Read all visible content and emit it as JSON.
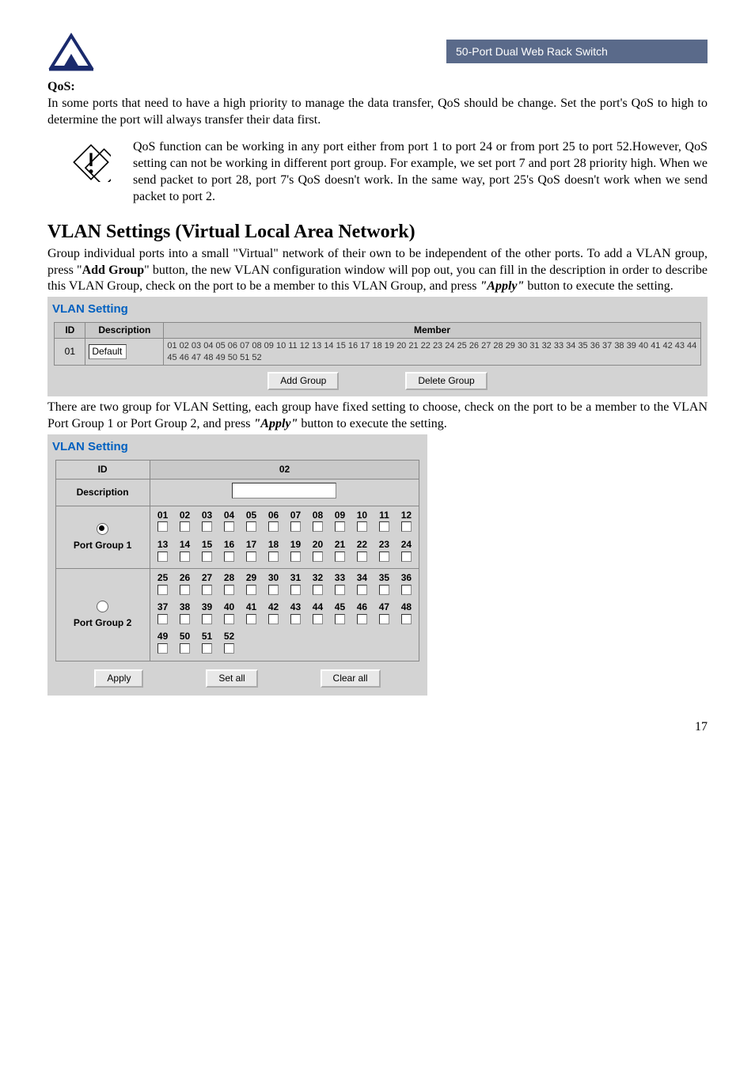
{
  "header": {
    "product": "50-Port Dual Web Rack Switch"
  },
  "qos": {
    "label": "QoS:",
    "body": "In some ports that need to have a high priority to manage the data transfer, QoS should be change. Set the port's QoS to high to determine the port will always transfer their data first.",
    "note": "QoS function can be working in any port either from port 1 to port 24 or from port 25 to port 52.However, QoS setting can not be working in different port group. For example, we set port 7 and port 28 priority high. When we send packet to port 28, port 7's QoS doesn't work. In the same way, port 25's QoS doesn't work when we send packet to port 2."
  },
  "vlan": {
    "heading": "VLAN Settings (Virtual Local Area Network)",
    "intro_plain_before": "Group individual ports into a small \"Virtual\" network of their own to be independent of the other ports. To add a VLAN group, press \"",
    "add_group_bold": "Add Group",
    "intro_plain_mid": "\" button, the new VLAN configuration window will pop out, you can fill in the description in order to describe this VLAN Group, check on the port to be a member to this VLAN Group, and press ",
    "apply_bold": "\"Apply\"",
    "intro_plain_after": " button to execute the setting.",
    "panel_title": "VLAN Setting",
    "table": {
      "col_id": "ID",
      "col_desc": "Description",
      "col_member": "Member",
      "row_id": "01",
      "row_desc": "Default",
      "row_member": "01 02 03 04 05 06 07 08 09 10 11 12 13 14 15 16 17 18 19 20 21 22 23 24 25 26 27 28 29 30 31 32 33 34 35 36 37 38 39 40 41 42 43 44 45 46 47 48 49 50 51 52"
    },
    "btn_add": "Add Group",
    "btn_delete": "Delete Group",
    "para2_before": "There are two group for VLAN Setting, each group have fixed setting to choose, check on the port to be a member to the VLAN Port Group 1 or Port Group 2, and press ",
    "para2_apply": "\"Apply\"",
    "para2_after": " button to execute the setting."
  },
  "panel2": {
    "title": "VLAN Setting",
    "id_label": "ID",
    "id_value": "02",
    "desc_label": "Description",
    "group1_label": "Port Group 1",
    "group2_label": "Port Group 2",
    "ports_g1_a": [
      "01",
      "02",
      "03",
      "04",
      "05",
      "06",
      "07",
      "08",
      "09",
      "10",
      "11",
      "12"
    ],
    "ports_g1_b": [
      "13",
      "14",
      "15",
      "16",
      "17",
      "18",
      "19",
      "20",
      "21",
      "22",
      "23",
      "24"
    ],
    "ports_g2_a": [
      "25",
      "26",
      "27",
      "28",
      "29",
      "30",
      "31",
      "32",
      "33",
      "34",
      "35",
      "36"
    ],
    "ports_g2_b": [
      "37",
      "38",
      "39",
      "40",
      "41",
      "42",
      "43",
      "44",
      "45",
      "46",
      "47",
      "48"
    ],
    "ports_g2_c": [
      "49",
      "50",
      "51",
      "52"
    ],
    "btn_apply": "Apply",
    "btn_setall": "Set all",
    "btn_clearall": "Clear all"
  },
  "page_number": "17"
}
